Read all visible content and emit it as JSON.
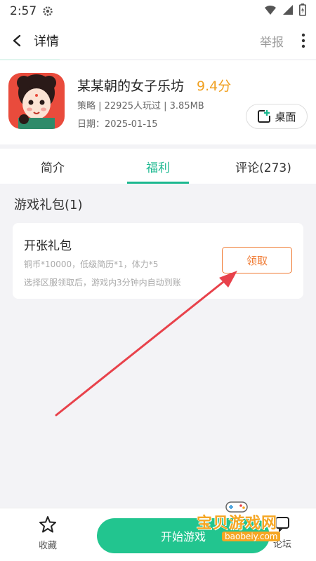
{
  "status_bar": {
    "time": "2:57"
  },
  "header": {
    "title": "详情",
    "report_label": "举报"
  },
  "app": {
    "name": "某某朝的女子乐坊",
    "score": "9.4分",
    "meta": "策略 | 22925人玩过 | 3.85MB",
    "date": "日期：2025-01-15",
    "desktop_label": "桌面"
  },
  "tabs": [
    {
      "label": "简介"
    },
    {
      "label": "福利"
    },
    {
      "label": "评论(273)"
    }
  ],
  "active_tab_index": 1,
  "gifts": {
    "section_title": "游戏礼包(1)",
    "items": [
      {
        "name": "开张礼包",
        "content": "铜币*10000，低级简历*1，体力*5",
        "note": "选择区服领取后，游戏内3分钟内自动到账",
        "claim_label": "领取"
      }
    ]
  },
  "bottom_bar": {
    "favorite_label": "收藏",
    "start_label": "开始游戏",
    "forum_label": "论坛"
  },
  "watermark": {
    "text": "宝贝游戏网",
    "url": "baobeiy.com"
  },
  "colors": {
    "accent": "#1cb890",
    "score": "#f0a020",
    "claim": "#f07a32",
    "arrow": "#e8424b"
  }
}
